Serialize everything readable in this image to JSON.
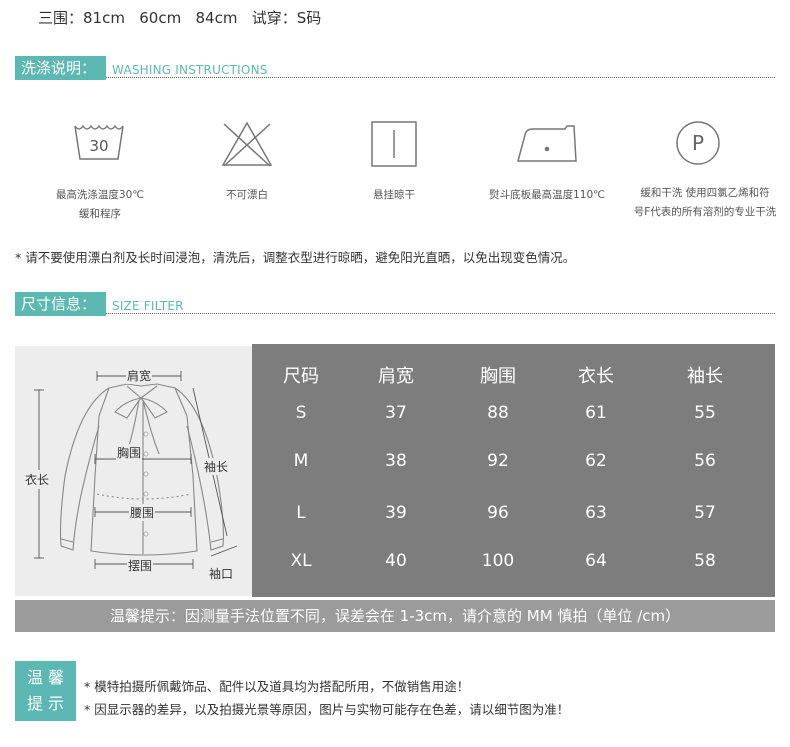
{
  "model_info": "三围：81cm   60cm   84cm   试穿：S码",
  "washing": {
    "title": "洗涤说明：",
    "subtitle": "WASHING INSTRUCTIONS",
    "items": [
      {
        "icon": "wash-30-icon",
        "label_line1": "最高洗涤温度30℃",
        "label_line2": "缓和程序",
        "temp": "30"
      },
      {
        "icon": "no-bleach-icon",
        "label_line1": "不可漂白",
        "label_line2": ""
      },
      {
        "icon": "hang-dry-icon",
        "label_line1": "悬挂晾干",
        "label_line2": ""
      },
      {
        "icon": "iron-icon",
        "label_line1": "熨斗底板最高温度110℃",
        "label_line2": ""
      },
      {
        "icon": "dry-clean-p-icon",
        "label_line1": "缓和干洗 使用四氯乙烯和符",
        "label_line2": "号F代表的所有溶剂的专业干洗",
        "letter": "P"
      }
    ],
    "note": "* 请不要使用漂白剂及长时间浸泡，清洗后，调整衣型进行晾晒，避免阳光直晒，以免出现变色情况。"
  },
  "size": {
    "title": "尺寸信息：",
    "subtitle": "SIZE FILTER",
    "diagram_labels": {
      "shoulder": "肩宽",
      "chest": "胸围",
      "length": "衣长",
      "sleeve": "袖长",
      "waist": "腰围",
      "hem": "摆围",
      "cuff": "袖口"
    },
    "table": {
      "headers": [
        "尺码",
        "肩宽",
        "胸围",
        "衣长",
        "袖长"
      ],
      "rows": [
        [
          "S",
          "37",
          "88",
          "61",
          "55"
        ],
        [
          "M",
          "38",
          "92",
          "62",
          "56"
        ],
        [
          "L",
          "39",
          "96",
          "63",
          "57"
        ],
        [
          "XL",
          "40",
          "100",
          "64",
          "58"
        ]
      ]
    },
    "tip": "温馨提示：因测量手法位置不同，误差会在 1-3cm，请介意的 MM 慎拍（单位 /cm）"
  },
  "warm_tips": {
    "label_line1": "温 馨",
    "label_line2": "提 示",
    "lines": [
      "* 模特拍摄所佩戴饰品、配件以及道具均为搭配所用，不做销售用途！",
      "* 因显示器的差异，以及拍摄光景等原因，图片与实物可能存在色差，请以细节图为准！"
    ]
  },
  "colors": {
    "accent": "#5cb8b2",
    "table_bg": "#7d7d7d",
    "tip_bg": "#9b9b9b",
    "diagram_bg": "#ededed"
  }
}
